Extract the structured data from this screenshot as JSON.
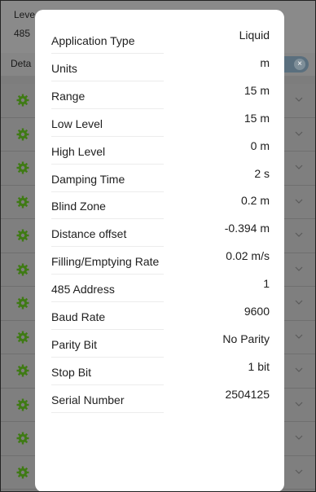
{
  "background": {
    "level_label": "Leve",
    "level_value": "485",
    "details_label": "Deta",
    "toggle_close_glyph": "×",
    "list_rows": 12
  },
  "dialog": {
    "fields": [
      {
        "label": "Application Type",
        "value": "Liquid"
      },
      {
        "label": "Units",
        "value": "m"
      },
      {
        "label": "Range",
        "value": "15 m"
      },
      {
        "label": "Low Level",
        "value": "15 m"
      },
      {
        "label": "High Level",
        "value": "0 m"
      },
      {
        "label": "Damping Time",
        "value": "2 s"
      },
      {
        "label": "Blind Zone",
        "value": "0.2 m"
      },
      {
        "label": "Distance offset",
        "value": "-0.394 m"
      },
      {
        "label": "Filling/Emptying Rate",
        "value": "0.02 m/s"
      },
      {
        "label": "485 Address",
        "value": "1"
      },
      {
        "label": "Baud Rate",
        "value": "9600"
      },
      {
        "label": "Parity Bit",
        "value": "No Parity"
      },
      {
        "label": "Stop Bit",
        "value": "1 bit"
      },
      {
        "label": "Serial Number",
        "value": "2504125"
      }
    ]
  },
  "colors": {
    "gear": "#3f7a14",
    "overlay": "#7d7d7d",
    "toggle": "#5a6f7e"
  }
}
